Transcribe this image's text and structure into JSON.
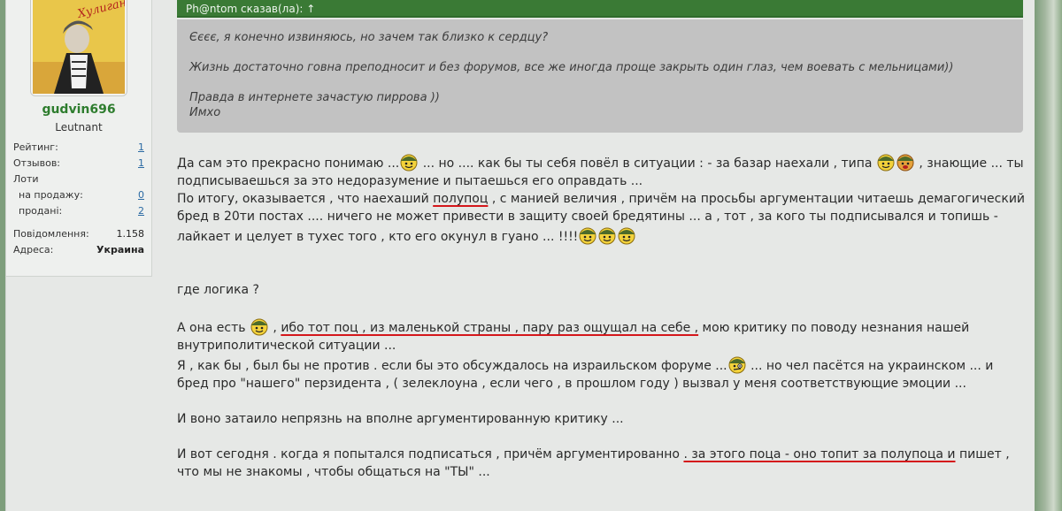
{
  "sidebar": {
    "username": "gudvin696",
    "rank": "Leutnant",
    "avatar_text": "Хулигана – к ответу!",
    "stats": {
      "rating_label": "Рейтинг:",
      "rating_value": "1",
      "reviews_label": "Отзывов:",
      "reviews_value": "1",
      "lots_label": "Лоти",
      "for_sale_label": "на продажу:",
      "for_sale_value": "0",
      "sold_label": "продані:",
      "sold_value": "2",
      "messages_label": "Повідомлення:",
      "messages_value": "1.158",
      "address_label": "Адреса:",
      "address_value": "Украина"
    }
  },
  "quote": {
    "header": "Ph@ntom сказав(ла): ↑",
    "lines": [
      "Єєєє, я конечно извиняюсь, но зачем так близко к сердцу?",
      "Жизнь достаточно говна преподносит и без форумов, все же иногда проще закрыть один глаз, чем воевать с мельницами))",
      "Правда в интернете зачастую пиррова ))",
      "Имхо"
    ]
  },
  "post": {
    "p1_a": "Да сам это прекрасно понимаю ...",
    "p1_b": " ... но .... как бы ты себя повёл в ситуации : - за базар наехали , типа ",
    "p1_c": " , знающие ... ты подписываешься за это недоразумение и пытаешься его оправдать ...",
    "p2_a": "По итогу, оказывается , что наехаший ",
    "p2_underlined": "полупоц",
    "p2_b": " , с манией величия , причём на просьбы аргументации читаешь демагогический бред в 20ти постах .... ничего не может привести в защиту своей бредятины ... а , тот , за кого ты подписывался и топишь - лайкает и целует в тухес того , кто его окунул в гуано ... !!!!",
    "p3": "где логика ?",
    "p4_a": "А она есть ",
    "p4_b": " , ",
    "p4_underlined": "ибо тот поц , из маленькой страны , пару раз ощущал на себе ,",
    "p4_c": " мою критику по поводу незнания нашей внутриполитической ситуации ...",
    "p5_a": "Я , как бы , был бы не против . если бы это обсуждалось на израильском форуме ...",
    "p5_b": " ... но чел пасётся на украинском ... и бред про \"нашего\" перзидента , ( зелеклоуна , если чего , в прошлом году ) вызвал у меня соответствующие эмоции ...",
    "p6": "И воно затаило непрязнь на вполне аргументированную критику ...",
    "p7_a": "И вот сегодня . когда я попытался подписаться , причём аргументированно ",
    "p7_underlined": ". за этого поца - оно топит за полупоца и",
    "p7_b": " пишет , что мы не знакомы , чтобы общаться на \"ТЫ\" ..."
  },
  "colors": {
    "quote_header_bg": "#3a7a35",
    "username": "#2e7d2e",
    "link": "#2b6aa3",
    "underline_red": "#d4171b"
  },
  "icons": [
    "soldier-smiley-icon",
    "soldier-angry-smiley-icon",
    "soldier-confused-smiley-icon"
  ]
}
